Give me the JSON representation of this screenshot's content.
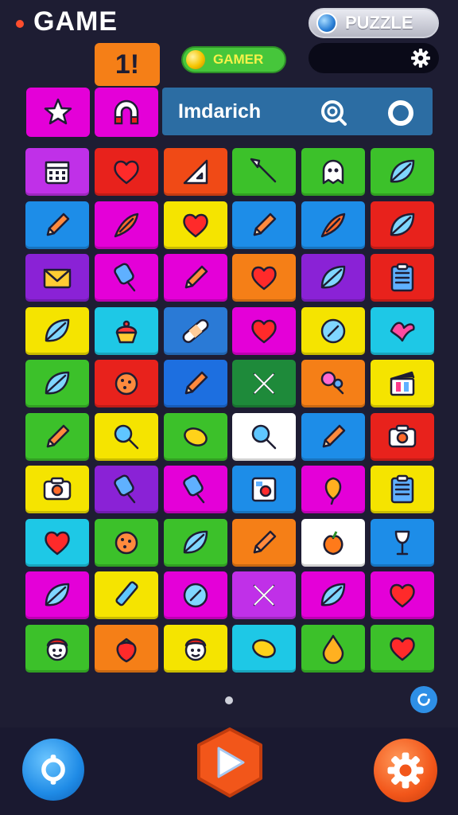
{
  "header": {
    "title": "GAME",
    "puzzle_label": "PUZZLE",
    "level_badge": "1!",
    "gamer_label": "GAMER"
  },
  "search": {
    "text": "Imdarich"
  },
  "grid": {
    "rows": [
      [
        {
          "color": "#c030e8",
          "icon": "calendar-icon"
        },
        {
          "color": "#e8221c",
          "icon": "heart-icon"
        },
        {
          "color": "#f04a16",
          "icon": "triangle-ruler-icon"
        },
        {
          "color": "#3cc12a",
          "icon": "wand-icon"
        },
        {
          "color": "#3cc12a",
          "icon": "ghost-icon"
        },
        {
          "color": "#3cc12a",
          "icon": "leaf-icon"
        }
      ],
      [
        {
          "color": "#1d8de8",
          "icon": "pencil-icon"
        },
        {
          "color": "#e400d8",
          "icon": "feather-icon"
        },
        {
          "color": "#f5e400",
          "icon": "heart-icon"
        },
        {
          "color": "#1d8de8",
          "icon": "pencil-icon"
        },
        {
          "color": "#1d8de8",
          "icon": "feather-icon"
        },
        {
          "color": "#e8221c",
          "icon": "leaf-icon"
        }
      ],
      [
        {
          "color": "#8a22d6",
          "icon": "envelope-icon"
        },
        {
          "color": "#e400d8",
          "icon": "popsicle-icon"
        },
        {
          "color": "#e400d8",
          "icon": "pencil-icon"
        },
        {
          "color": "#f57f17",
          "icon": "heart-icon"
        },
        {
          "color": "#8a22d6",
          "icon": "leaf-icon"
        },
        {
          "color": "#e8221c",
          "icon": "notepad-icon"
        }
      ],
      [
        {
          "color": "#f5e400",
          "icon": "leaf-icon"
        },
        {
          "color": "#1ec8e6",
          "icon": "cupcake-icon"
        },
        {
          "color": "#2a7ad6",
          "icon": "bandage-icon"
        },
        {
          "color": "#e400d8",
          "icon": "heart-icon"
        },
        {
          "color": "#f5e400",
          "icon": "coin-icon"
        },
        {
          "color": "#1ec8e6",
          "icon": "bird-icon"
        }
      ],
      [
        {
          "color": "#3cc12a",
          "icon": "leaf-icon"
        },
        {
          "color": "#e8221c",
          "icon": "cookie-icon"
        },
        {
          "color": "#1d6fe0",
          "icon": "pencil-icon"
        },
        {
          "color": "#1e8a3a",
          "icon": "cross-icon"
        },
        {
          "color": "#f57f17",
          "icon": "lollipop-icon"
        },
        {
          "color": "#f5e400",
          "icon": "clapper-icon"
        }
      ],
      [
        {
          "color": "#3cc12a",
          "icon": "pencil-icon"
        },
        {
          "color": "#f5e400",
          "icon": "magnifier-icon"
        },
        {
          "color": "#3cc12a",
          "icon": "lemon-icon"
        },
        {
          "color": "#ffffff",
          "icon": "magnifier-icon"
        },
        {
          "color": "#1d8de8",
          "icon": "pencil-icon"
        },
        {
          "color": "#e8221c",
          "icon": "camera-icon"
        }
      ],
      [
        {
          "color": "#f5e400",
          "icon": "camera-icon"
        },
        {
          "color": "#8a22d6",
          "icon": "popsicle-icon"
        },
        {
          "color": "#e400d8",
          "icon": "popsicle-icon"
        },
        {
          "color": "#1d8de8",
          "icon": "photo-icon"
        },
        {
          "color": "#e400d8",
          "icon": "balloon-icon"
        },
        {
          "color": "#f5e400",
          "icon": "notepad-icon"
        }
      ],
      [
        {
          "color": "#1ec8e6",
          "icon": "heart-icon"
        },
        {
          "color": "#3cc12a",
          "icon": "cookie-icon"
        },
        {
          "color": "#3cc12a",
          "icon": "leaf-icon"
        },
        {
          "color": "#f57f17",
          "icon": "pencil-icon"
        },
        {
          "color": "#ffffff",
          "icon": "peach-icon"
        },
        {
          "color": "#1d8de8",
          "icon": "goblet-icon"
        }
      ],
      [
        {
          "color": "#e400d8",
          "icon": "leaf-icon"
        },
        {
          "color": "#f5e400",
          "icon": "flashlight-icon"
        },
        {
          "color": "#e400d8",
          "icon": "coin-icon"
        },
        {
          "color": "#c030e8",
          "icon": "cross-icon"
        },
        {
          "color": "#e400d8",
          "icon": "leaf-icon"
        },
        {
          "color": "#e400d8",
          "icon": "heart-icon"
        }
      ],
      [
        {
          "color": "#3cc12a",
          "icon": "face-icon"
        },
        {
          "color": "#f57f17",
          "icon": "strawberry-icon"
        },
        {
          "color": "#f5e400",
          "icon": "face-icon"
        },
        {
          "color": "#1ec8e6",
          "icon": "lemon-icon"
        },
        {
          "color": "#3cc12a",
          "icon": "drop-icon"
        },
        {
          "color": "#3cc12a",
          "icon": "heart-icon"
        }
      ]
    ]
  }
}
